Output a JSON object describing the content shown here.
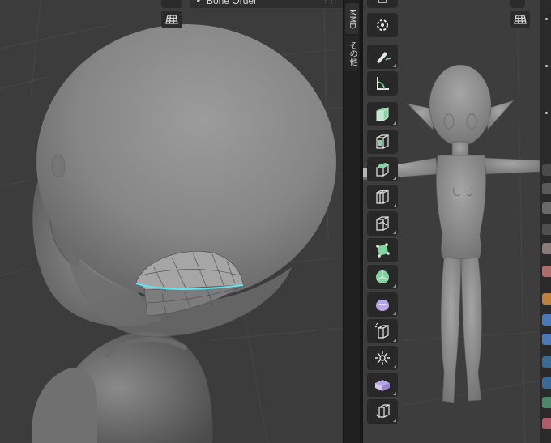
{
  "panel": {
    "collapse_glyph": "▸",
    "title": "Bone Order",
    "drag_glyph": "⋮⋮"
  },
  "tabs": [
    {
      "label": "MMD",
      "active": true
    },
    {
      "label": "その他",
      "active": false
    }
  ],
  "toolbar": {
    "tools": [
      {
        "icon": "cursor-icon"
      },
      {
        "icon": "annotate-icon"
      },
      {
        "icon": "measure-icon"
      },
      {
        "icon": "extrude-region-icon"
      },
      {
        "icon": "inset-faces-icon"
      },
      {
        "icon": "bevel-icon"
      },
      {
        "icon": "loop-cut-icon"
      },
      {
        "icon": "knife-icon"
      },
      {
        "icon": "poly-build-icon"
      },
      {
        "icon": "spin-icon"
      },
      {
        "icon": "smooth-vertices-icon"
      },
      {
        "icon": "edge-slide-icon"
      },
      {
        "icon": "shrink-fatten-icon"
      },
      {
        "icon": "shear-icon"
      },
      {
        "icon": "rip-region-icon"
      }
    ]
  },
  "colors": {
    "viewport_bg": "#3c3c3c",
    "mesh_gray": "#8a8a8a",
    "selected_edge": "#5fe3ee",
    "tool_green": "#7fd4a0",
    "tool_purple": "#b9a6e6"
  },
  "viewports": {
    "left": {
      "grid_icon": "grid-view-icon"
    },
    "right": {
      "grid_icon": "grid-view-icon"
    }
  }
}
